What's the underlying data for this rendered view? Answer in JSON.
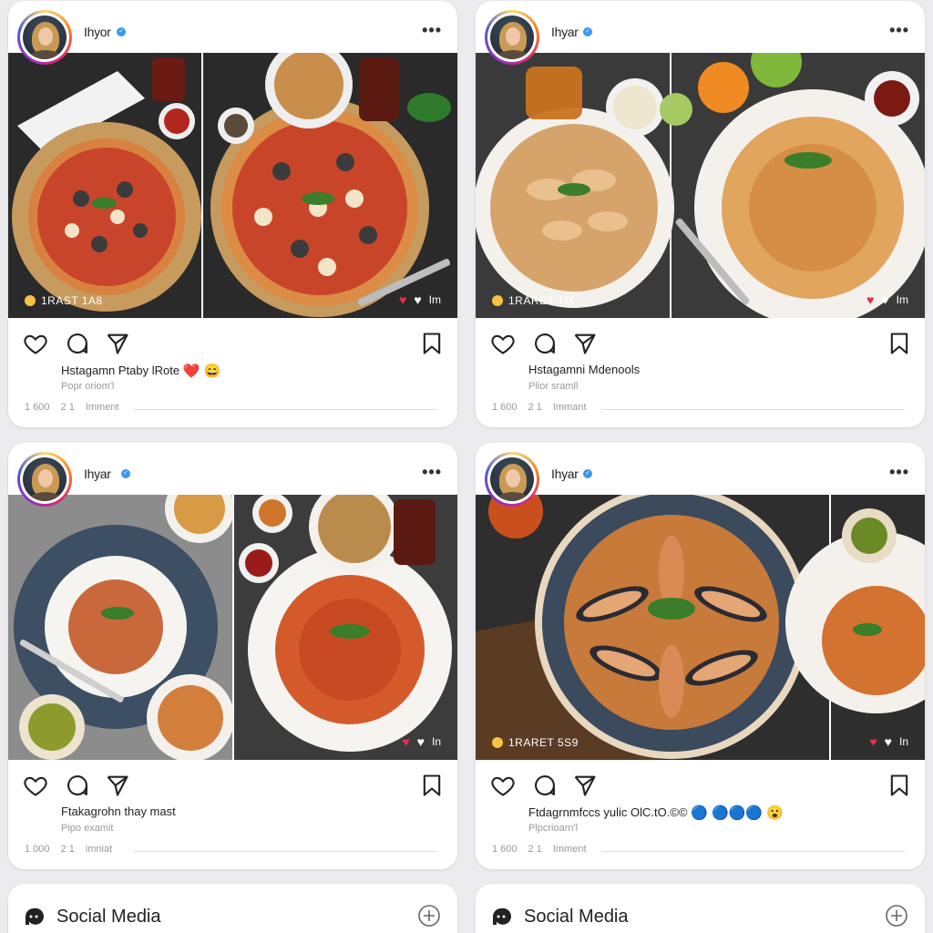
{
  "posts": [
    {
      "username": "Ihyor",
      "overlay_left": "1RAST 1A8",
      "overlay_right": "Im",
      "caption": "Hstagamn Ptaby lRote",
      "caption_emojis": "❤️ 😄",
      "subcaption": "Popr oriom'l",
      "stats": [
        "1 600",
        "2 1",
        "Imment"
      ]
    },
    {
      "username": "Ihyar",
      "overlay_left": "1RARET 1M",
      "overlay_right": "Im",
      "caption": "Hstagamni Mdenools",
      "caption_emojis": "",
      "subcaption": "Plior sramll",
      "stats": [
        "1 600",
        "2 1",
        "Immant"
      ]
    },
    {
      "username": "Ihyar",
      "overlay_left": "",
      "overlay_right": "In",
      "caption": "Ftakagrohn thay mast",
      "caption_emojis": "",
      "subcaption": "Pipo examit",
      "stats": [
        "1 000",
        "2 1",
        "imniat"
      ]
    },
    {
      "username": "Ihyar",
      "overlay_left": "1RARET 5S9",
      "overlay_right": "In",
      "caption": "Ftdagrnmfccs yulic OlC.tO.©©",
      "caption_emojis": "🔵 🔵🔵🔵 😮",
      "subcaption": "Plpcrioarn'l",
      "stats": [
        "1 600",
        "2 1",
        "Imment"
      ]
    }
  ],
  "bottom": [
    {
      "label": "Social Media"
    },
    {
      "label": "Social Media"
    }
  ],
  "colors": {
    "verified": "#3897f0",
    "ring": [
      "#feda75",
      "#fa7e1e",
      "#d62976",
      "#962fbf"
    ],
    "heart": "#e8304a"
  },
  "icons": [
    "heart-icon",
    "comment-icon",
    "share-icon",
    "bookmark-icon",
    "more-icon",
    "plus-circle-icon",
    "chat-bubble-icon"
  ]
}
